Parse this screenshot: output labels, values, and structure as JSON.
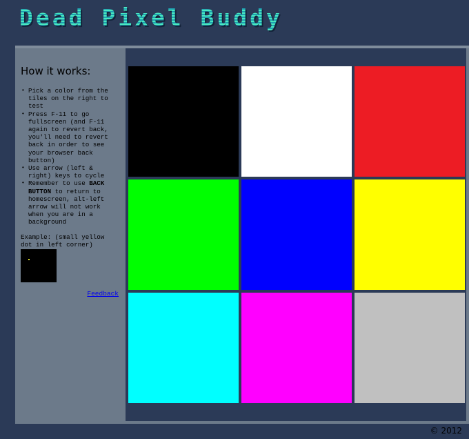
{
  "app": {
    "title": "Dead Pixel Buddy"
  },
  "sidebar": {
    "heading": "How it works:",
    "items": [
      "Pick a color from the tiles on the right to test",
      "Press F-11 to go fullscreen (and F-11 again to revert back, you'll need to revert back in order to see your browser back button)",
      "Use arrow (left & right) keys to cycle",
      "Remember to use BACK BUTTON to return to homescreen, alt-left arrow will not work when you are in a background"
    ],
    "item4_prefix": "Remember to use ",
    "item4_bold": "BACK BUTTON",
    "item4_suffix": " to return to homescreen, alt-left arrow will not work when you are in a background",
    "example_label": "Example: (small yellow dot in left corner)",
    "feedback_label": "Feedback"
  },
  "tiles": [
    {
      "name": "black",
      "color": "#000000"
    },
    {
      "name": "white",
      "color": "#ffffff"
    },
    {
      "name": "red",
      "color": "#ed1c24"
    },
    {
      "name": "green",
      "color": "#00ff00"
    },
    {
      "name": "blue",
      "color": "#0000ff"
    },
    {
      "name": "yellow",
      "color": "#ffff00"
    },
    {
      "name": "cyan",
      "color": "#00ffff"
    },
    {
      "name": "magenta",
      "color": "#ff00ff"
    },
    {
      "name": "silver",
      "color": "#c0c0c0"
    }
  ],
  "footer": {
    "copyright": "© 2012"
  },
  "colors": {
    "background": "#2b3a57",
    "sidebar": "#6c7a8a",
    "logo": "#2fd1a8",
    "example_dot": "#d8d82a",
    "link": "#0000ee"
  }
}
